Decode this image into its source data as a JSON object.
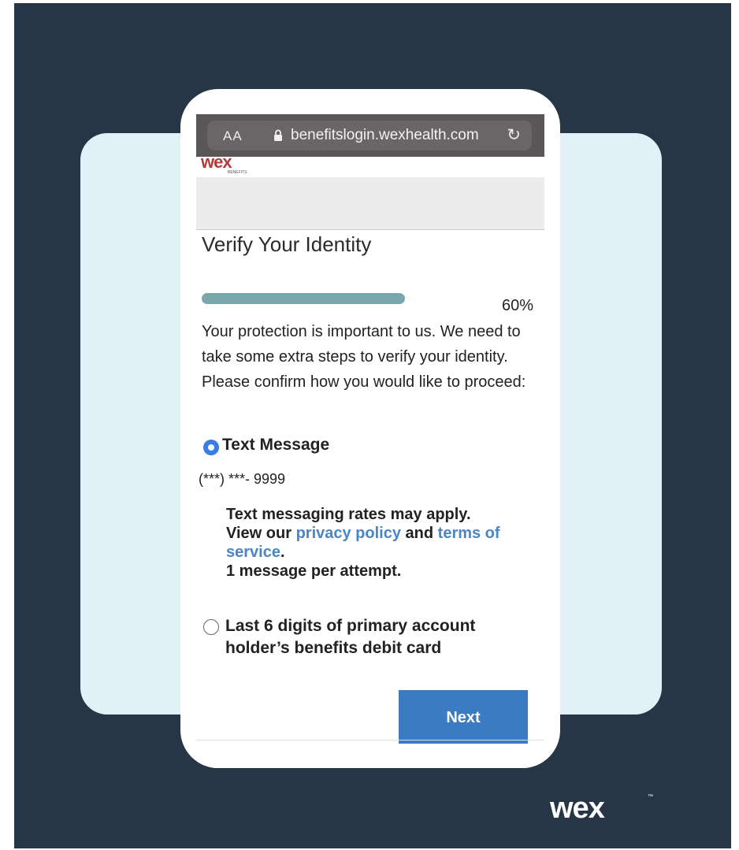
{
  "browser": {
    "text_size_label": "AA",
    "url": "benefitslogin.wexhealth.com",
    "reload_icon": "reload-icon",
    "lock_icon": "lock-icon"
  },
  "site": {
    "logo_text": "wex",
    "logo_subtext": "BENEFITS"
  },
  "page": {
    "title": "Verify Your Identity",
    "progress_value": 0.6,
    "progress_label": "60%",
    "intro": "Your protection is important to us. We need to take some extra steps to verify your identity. Please confirm how you would like to proceed:"
  },
  "options": {
    "text_message": {
      "label": "Text Message",
      "selected": true,
      "masked_phone": "(***) ***- 9999",
      "note_line1": "Text messaging rates may apply.",
      "note_view": "View our",
      "privacy_link": "privacy policy",
      "note_and": "and",
      "terms_link": "terms of service",
      "note_period": ".",
      "note_line3": "1 message per attempt."
    },
    "debit_card": {
      "label": "Last 6 digits of primary account holder’s benefits debit card",
      "selected": false
    }
  },
  "actions": {
    "next_label": "Next"
  },
  "footer": {
    "brand": "wex",
    "trademark": "™"
  },
  "colors": {
    "background": "#263646",
    "card": "#e2f0f8",
    "accent": "#3a7bc1",
    "link": "#4a86c5",
    "progress": "#7aa7ac"
  }
}
